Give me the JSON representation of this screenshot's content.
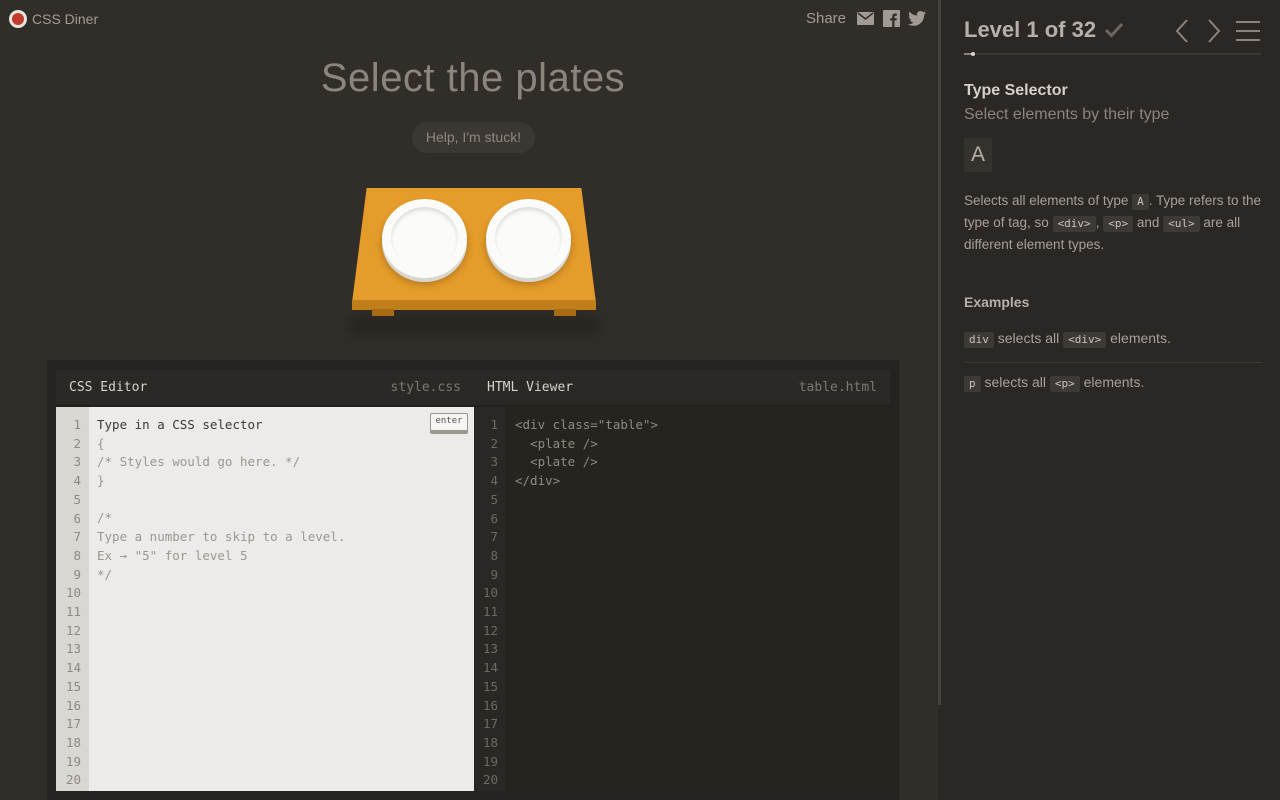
{
  "app": {
    "logo_text": "CSS Diner",
    "share_label": "Share",
    "share_icons": [
      "email-icon",
      "facebook-icon",
      "twitter-icon"
    ]
  },
  "level": {
    "instruction": "Select the plates",
    "help_button": "Help, I'm stuck!",
    "table_items": [
      "plate",
      "plate"
    ],
    "title": "Level 1 of 32",
    "current": 1,
    "total": 32,
    "completed_icon": "check-icon"
  },
  "editor": {
    "css_title": "CSS Editor",
    "css_file": "style.css",
    "html_title": "HTML Viewer",
    "html_file": "table.html",
    "enter_label": "enter",
    "css_lines": [
      "Type in a CSS selector",
      "{",
      "/* Styles would go here. */",
      "}",
      "",
      "/*",
      "Type a number to skip to a level.",
      "Ex → \"5\" for level 5",
      "*/"
    ],
    "html_lines": [
      "<div class=\"table\">",
      "  <plate />",
      "  <plate />",
      "</div>"
    ],
    "line_numbers": [
      "1",
      "2",
      "3",
      "4",
      "5",
      "6",
      "7",
      "8",
      "9",
      "10",
      "11",
      "12",
      "13",
      "14",
      "15",
      "16",
      "17",
      "18",
      "19",
      "20"
    ]
  },
  "sidebar": {
    "selector_name": "Type Selector",
    "selector_desc": "Select elements by their type",
    "syntax": "A",
    "hint": {
      "t1": "Selects all elements of type ",
      "tag_a": "A",
      "t2": ". Type refers to the type of tag, so ",
      "tag_div": "<div>",
      "t3": ", ",
      "tag_p": "<p>",
      "t4": " and ",
      "tag_ul": "<ul>",
      "t5": " are all different element types."
    },
    "examples_title": "Examples",
    "examples": [
      {
        "code": "div",
        "text1": " selects all ",
        "code2": "<div>",
        "text2": " elements."
      },
      {
        "code": "p",
        "text1": " selects all ",
        "code2": "<p>",
        "text2": " elements."
      }
    ],
    "progress_fraction": 0.03125,
    "nav_icons": [
      "prev-level-icon",
      "next-level-icon",
      "menu-icon"
    ]
  },
  "colors": {
    "background": "#312d29",
    "sidebar": "#2a2724",
    "table": "#e59c2a",
    "plate": "#fbfbfa",
    "logo_red": "#c23c2e"
  }
}
